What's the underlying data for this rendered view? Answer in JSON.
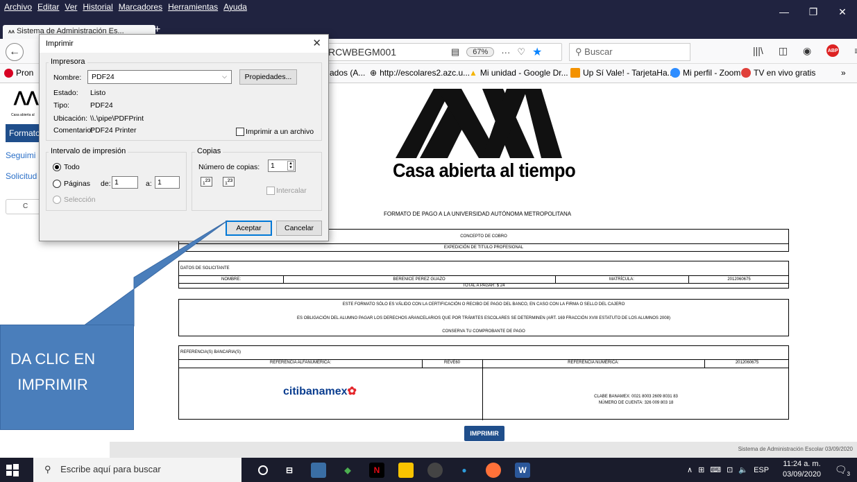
{
  "menubar": {
    "items": [
      "Archivo",
      "Editar",
      "Ver",
      "Historial",
      "Marcadores",
      "Herramientas",
      "Ayuda"
    ]
  },
  "tab": {
    "title": "Sistema de Administración Es..."
  },
  "navbar": {
    "url": "RCWBEGM001",
    "zoom": "67%",
    "search_placeholder": "Buscar"
  },
  "bookmarks": [
    "Pron",
    "ados (A...",
    "http://escolares2.azc.u...",
    "Mi unidad - Google Dr...",
    "Up Sí Vale! - TarjetaHa...",
    "Mi perfil - Zoom",
    "TV en vivo gratis"
  ],
  "sidebar": {
    "formato": "Formato",
    "seguimiento": "Seguimi",
    "solicitud": "Solicitud",
    "btn": "C",
    "logo_sub": "Casa abierta al"
  },
  "document": {
    "logo_text": "Casa abierta al tiempo",
    "title": "FORMATO DE PAGO A LA UNIVERSIDAD AUTÓNOMA METROPOLITANA",
    "concepto_label": "CONCEPTO DE COBRO",
    "concepto_value": "EXPEDICIÓN DE TITULO PROFESIONAL",
    "datos_label": "DATOS DE SOLICITANTE",
    "nombre_label": "NOMBRE:",
    "nombre_value": "BERENICE PEREZ GUAZO",
    "matricula_label": "MATRÍCULA:",
    "matricula_value": "2012060675",
    "total": "TOTAL A PAGAR: $ 24",
    "note1": "ESTE FORMATO SÓLO ES VÁLIDO CON LA CERTIFICACIÓN O RECIBO DE PAGO DEL BANCO, EN CASO CON LA FIRMA O SELLO DEL CAJERO",
    "note2": "ES OBLIGACIÓN DEL ALUMNO PAGAR LOS DERECHOS ARANCELARIOS QUE POR TRÁMITES ESCOLARES SE DETERMINEN (ART. 169 FRACCIÓN XVIII ESTATUTO DE LOS ALUMNOS 2008)",
    "note3": "CONSERVA TU COMPROBANTE DE PAGO",
    "ref_label": "REFERENCIA(S) BANCARIA(S)",
    "ref_alfa_label": "REFERENCIA ALFANUMERICA:",
    "ref_alfa_value": "REVE60",
    "ref_num_label": "REFERENCIA NUMÉRICA:",
    "ref_num_value": "2012060675",
    "bank_name": "citibanamex",
    "clabe": "CLABE BANAMEX: 0021 8003 2609 8031 83",
    "cuenta": "NÚMERO DE CUENTA: 326 009 803 18",
    "imprimir_btn": "IMPRIMIR",
    "footer": "Sistema de Administración Escolar 03/09/2020"
  },
  "dialog": {
    "title": "Imprimir",
    "printer_group": "Impresora",
    "nombre_label": "Nombre:",
    "nombre_value": "PDF24",
    "propiedades": "Propiedades...",
    "estado_label": "Estado:",
    "estado_value": "Listo",
    "tipo_label": "Tipo:",
    "tipo_value": "PDF24",
    "ubicacion_label": "Ubicación:",
    "ubicacion_value": "\\\\.\\pipe\\PDFPrint",
    "comentario_label": "Comentario:",
    "comentario_value": "PDF24 Printer",
    "imprimir_archivo": "Imprimir a un archivo",
    "range_group": "Intervalo de impresión",
    "todo": "Todo",
    "paginas": "Páginas",
    "de_label": "de:",
    "de_value": "1",
    "a_label": "a:",
    "a_value": "1",
    "seleccion": "Selección",
    "copies_group": "Copias",
    "num_copias_label": "Número de copias:",
    "num_copias_value": "1",
    "intercalar": "Intercalar",
    "aceptar": "Aceptar",
    "cancelar": "Cancelar"
  },
  "callout": {
    "line1": "DA CLIC EN",
    "line2": "IMPRIMIR"
  },
  "taskbar": {
    "search_placeholder": "Escribe aquí para buscar",
    "lang": "ESP",
    "time": "11:24 a. m.",
    "date": "03/09/2020",
    "notif_count": "3"
  }
}
